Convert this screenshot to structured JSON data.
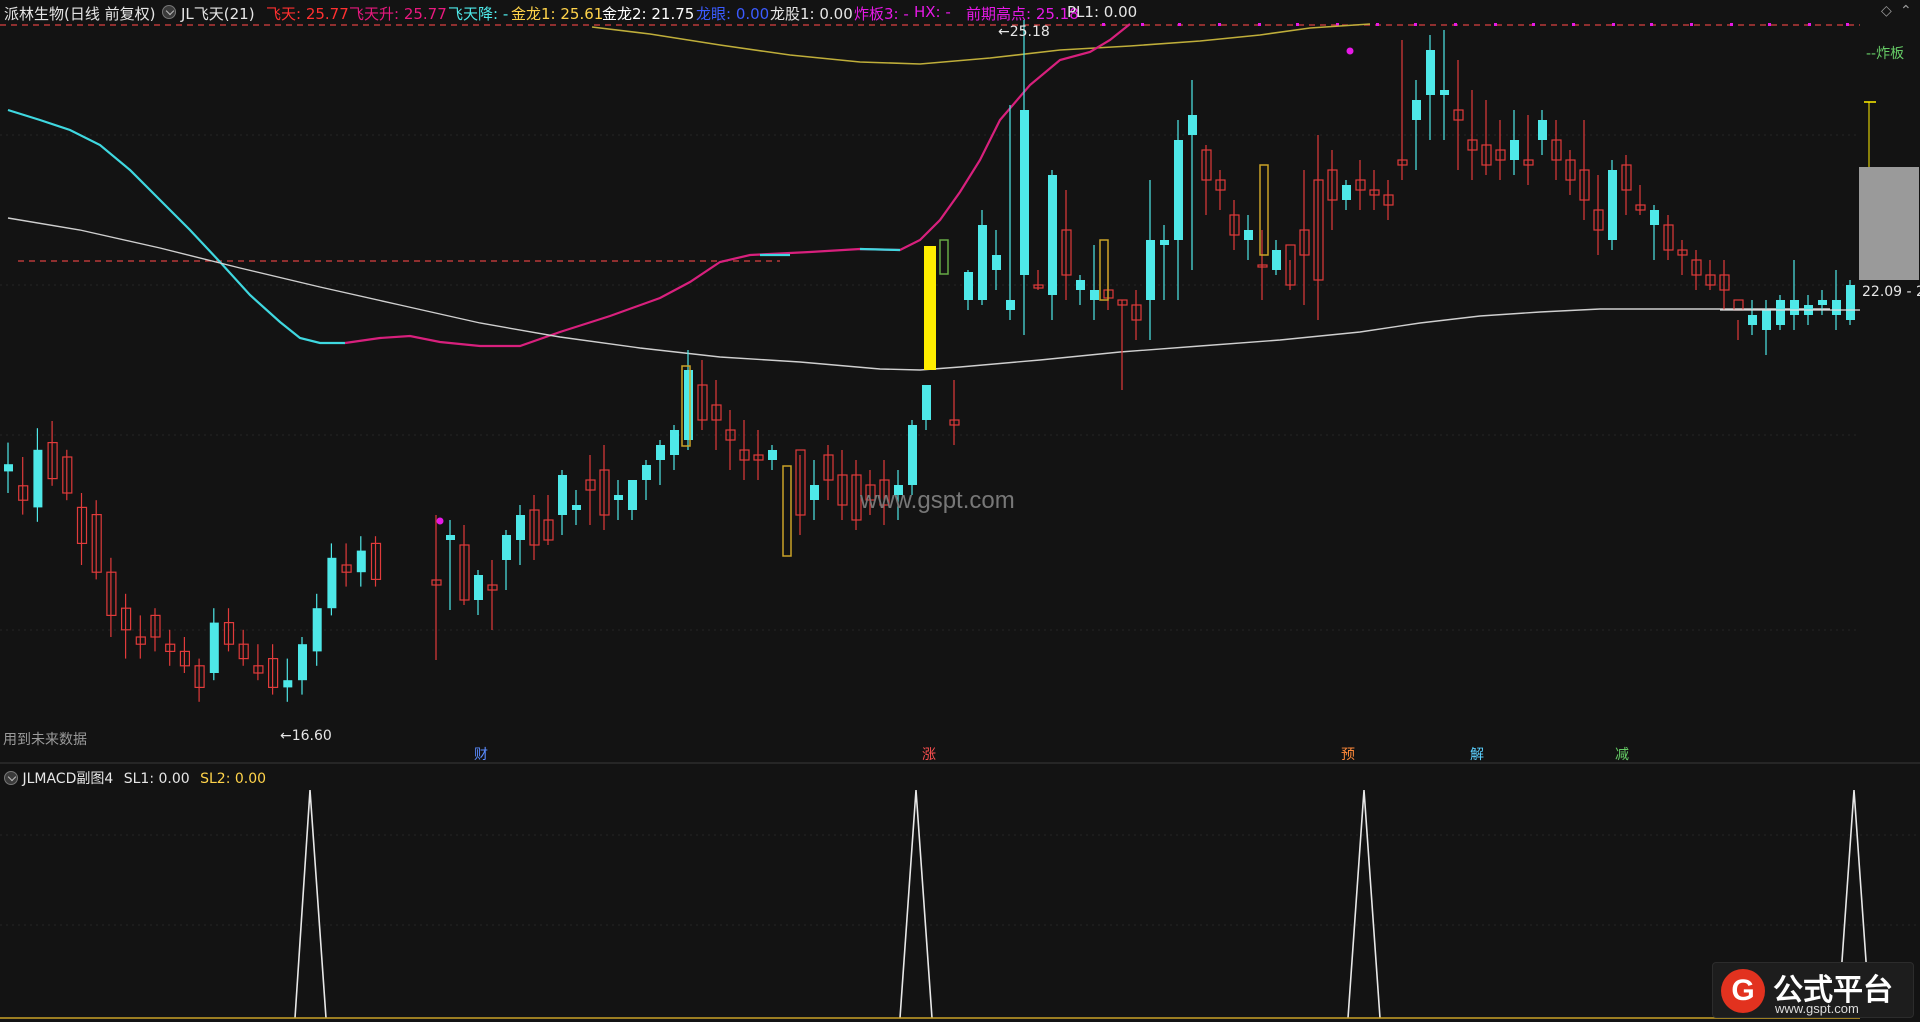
{
  "header": {
    "stock": "派林生物(日线 前复权)",
    "indicator": "JL飞天(21)",
    "feitian": "飞天: 25.77",
    "feitian_sheng": "飞天升: 25.77",
    "feitian_jiang": "飞天降: -",
    "jinlong1": "金龙1: 25.61",
    "jinlong2": "金龙2: 21.75",
    "longbian": "龙眼: 0.00",
    "longgu1": "龙股1: 0.00",
    "zhaban3": "炸板3: -",
    "hx": "HX: -",
    "qianqi": "前期高点: 25.18",
    "pl1": "PL1: 0.00"
  },
  "main_chart": {
    "high_label": "25.18",
    "low_label": "16.60",
    "price_tag": "22.09 - 2",
    "zhaban_label": "--炸板",
    "note": "用到未来数据",
    "markers": [
      "财",
      "涨",
      "预",
      "解",
      "减"
    ],
    "watermark": "www.gspt.com",
    "colors": {
      "up": "#e03b3b",
      "down": "#4ee8e8",
      "gold": "#c9a227",
      "magenta": "#e8197f",
      "white_ma": "#d0d0d0",
      "yellow_bar": "#ffee00"
    }
  },
  "sub_chart": {
    "title": "JLMACD副图4",
    "sl1": "SL1: 0.00",
    "sl2": "SL2: 0.00",
    "peak_count": 4
  },
  "logo": {
    "text": "公式平台",
    "url": "www.gspt.com",
    "glyph": "G"
  },
  "chart_data": {
    "type": "candlestick",
    "price_range": [
      16.6,
      25.77
    ],
    "candles": [
      {
        "o": 19.8,
        "h": 20.2,
        "l": 19.5,
        "c": 19.9
      },
      {
        "o": 19.6,
        "h": 20.0,
        "l": 19.2,
        "c": 19.4
      },
      {
        "o": 19.3,
        "h": 20.4,
        "l": 19.1,
        "c": 20.1
      },
      {
        "o": 20.2,
        "h": 20.5,
        "l": 19.6,
        "c": 19.7
      },
      {
        "o": 20.0,
        "h": 20.1,
        "l": 19.4,
        "c": 19.5
      },
      {
        "o": 19.3,
        "h": 19.5,
        "l": 18.5,
        "c": 18.8
      },
      {
        "o": 19.2,
        "h": 19.4,
        "l": 18.3,
        "c": 18.4
      },
      {
        "o": 18.4,
        "h": 18.6,
        "l": 17.5,
        "c": 17.8
      },
      {
        "o": 17.9,
        "h": 18.1,
        "l": 17.2,
        "c": 17.6
      },
      {
        "o": 17.5,
        "h": 17.8,
        "l": 17.2,
        "c": 17.4
      },
      {
        "o": 17.8,
        "h": 17.9,
        "l": 17.3,
        "c": 17.5
      },
      {
        "o": 17.4,
        "h": 17.6,
        "l": 17.1,
        "c": 17.3
      },
      {
        "o": 17.3,
        "h": 17.5,
        "l": 17.0,
        "c": 17.1
      },
      {
        "o": 17.1,
        "h": 17.2,
        "l": 16.6,
        "c": 16.8
      },
      {
        "o": 17.0,
        "h": 17.9,
        "l": 16.9,
        "c": 17.7
      },
      {
        "o": 17.7,
        "h": 17.9,
        "l": 17.3,
        "c": 17.4
      },
      {
        "o": 17.4,
        "h": 17.6,
        "l": 17.1,
        "c": 17.2
      },
      {
        "o": 17.1,
        "h": 17.4,
        "l": 16.9,
        "c": 17.0
      },
      {
        "o": 17.2,
        "h": 17.4,
        "l": 16.7,
        "c": 16.8
      },
      {
        "o": 16.8,
        "h": 17.2,
        "l": 16.6,
        "c": 16.9
      },
      {
        "o": 16.9,
        "h": 17.5,
        "l": 16.7,
        "c": 17.4
      },
      {
        "o": 17.3,
        "h": 18.1,
        "l": 17.1,
        "c": 17.9
      },
      {
        "o": 17.9,
        "h": 18.8,
        "l": 17.8,
        "c": 18.6
      },
      {
        "o": 18.5,
        "h": 18.8,
        "l": 18.2,
        "c": 18.4
      },
      {
        "o": 18.4,
        "h": 18.9,
        "l": 18.2,
        "c": 18.7
      },
      {
        "o": 18.8,
        "h": 18.9,
        "l": 18.2,
        "c": 18.3
      }
    ]
  }
}
